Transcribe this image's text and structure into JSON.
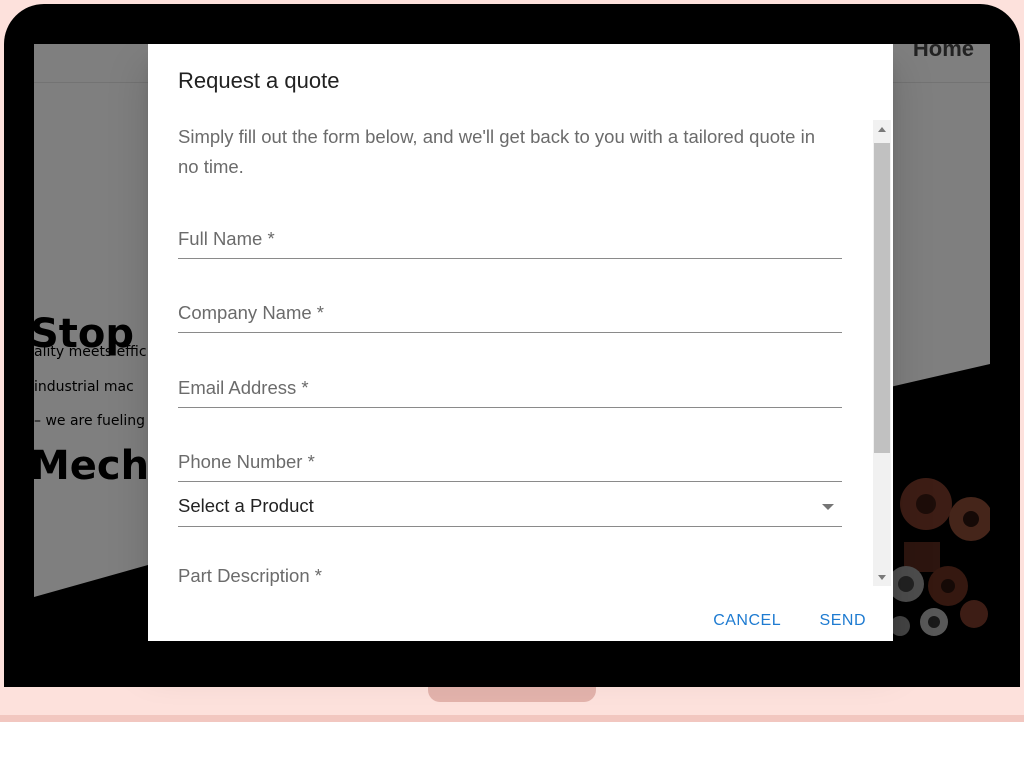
{
  "background_site": {
    "nav_home": "Home",
    "hero_title_lines": [
      "Stop S",
      "Mecha"
    ],
    "hero_text_lines": [
      "ality meets effic",
      " industrial mac",
      "– we are fueling"
    ]
  },
  "dialog": {
    "title": "Request a quote",
    "description": "Simply fill out the form below, and we'll get back to you with a tailored quote in no time.",
    "fields": {
      "full_name": {
        "label": "Full Name *"
      },
      "company_name": {
        "label": "Company Name *"
      },
      "email": {
        "label": "Email Address *"
      },
      "phone": {
        "label": "Phone Number *"
      },
      "product": {
        "value": "Select a Product"
      },
      "part_description": {
        "label": "Part Description *"
      }
    },
    "actions": {
      "cancel": "CANCEL",
      "send": "SEND"
    }
  },
  "icons": {
    "select_arrow": "caret-down-icon",
    "scroll_up": "scroll-up-arrow-icon",
    "scroll_down": "scroll-down-arrow-icon"
  },
  "colors": {
    "accent": "#1e7bd1",
    "laptop_frame": "#000000",
    "laptop_base": "#fde1dc"
  }
}
